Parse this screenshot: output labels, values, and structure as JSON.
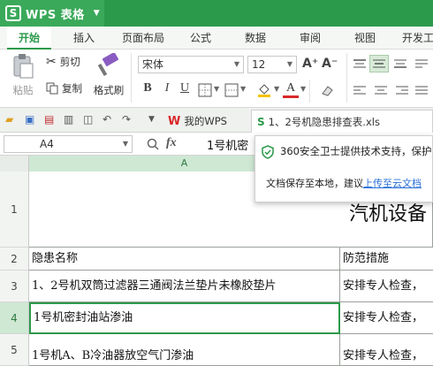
{
  "app": {
    "logo": "S",
    "title": "WPS 表格",
    "caret": "▼"
  },
  "menu": {
    "tabs": [
      "开始",
      "插入",
      "页面布局",
      "公式",
      "数据",
      "审阅",
      "视图",
      "开发工"
    ]
  },
  "ribbon": {
    "paste": "粘贴",
    "cut": "剪切",
    "copy": "复制",
    "format_painter": "格式刷",
    "font_name": "宋体",
    "font_size": "12",
    "bold": "B",
    "italic": "I",
    "underline": "U",
    "font_grow": "A⁺",
    "font_shrink": "A⁻",
    "font_color_letter": "A"
  },
  "doc_tabs": {
    "wps_label": "我的WPS",
    "file_label": "1、2号机隐患排查表.xls"
  },
  "formula_bar": {
    "cell_ref": "A4",
    "fx": "fx",
    "content": "1号机密"
  },
  "popup": {
    "line1": "360安全卫士提供技术支持，保护",
    "line2_prefix": "文档保存至本地，建议",
    "line2_link": "上传至云文档"
  },
  "grid": {
    "column_a": "A",
    "rows": [
      {
        "num": "1",
        "a": "",
        "b": "汽机设备"
      },
      {
        "num": "2",
        "a": "隐患名称",
        "b": "防范措施"
      },
      {
        "num": "3",
        "a": "1、2号机双筒过滤器三通阀法兰垫片未橡胶垫片",
        "b": "安排专人检查，"
      },
      {
        "num": "4",
        "a": "1号机密封油站渗油",
        "b": "安排专人检查，"
      },
      {
        "num": "5",
        "a": "1号机A、B冷油器放空气门渗油",
        "b": "安排专人检查，"
      }
    ]
  },
  "colors": {
    "brand_green": "#2c9a4b",
    "wps_red": "#d9282a"
  }
}
